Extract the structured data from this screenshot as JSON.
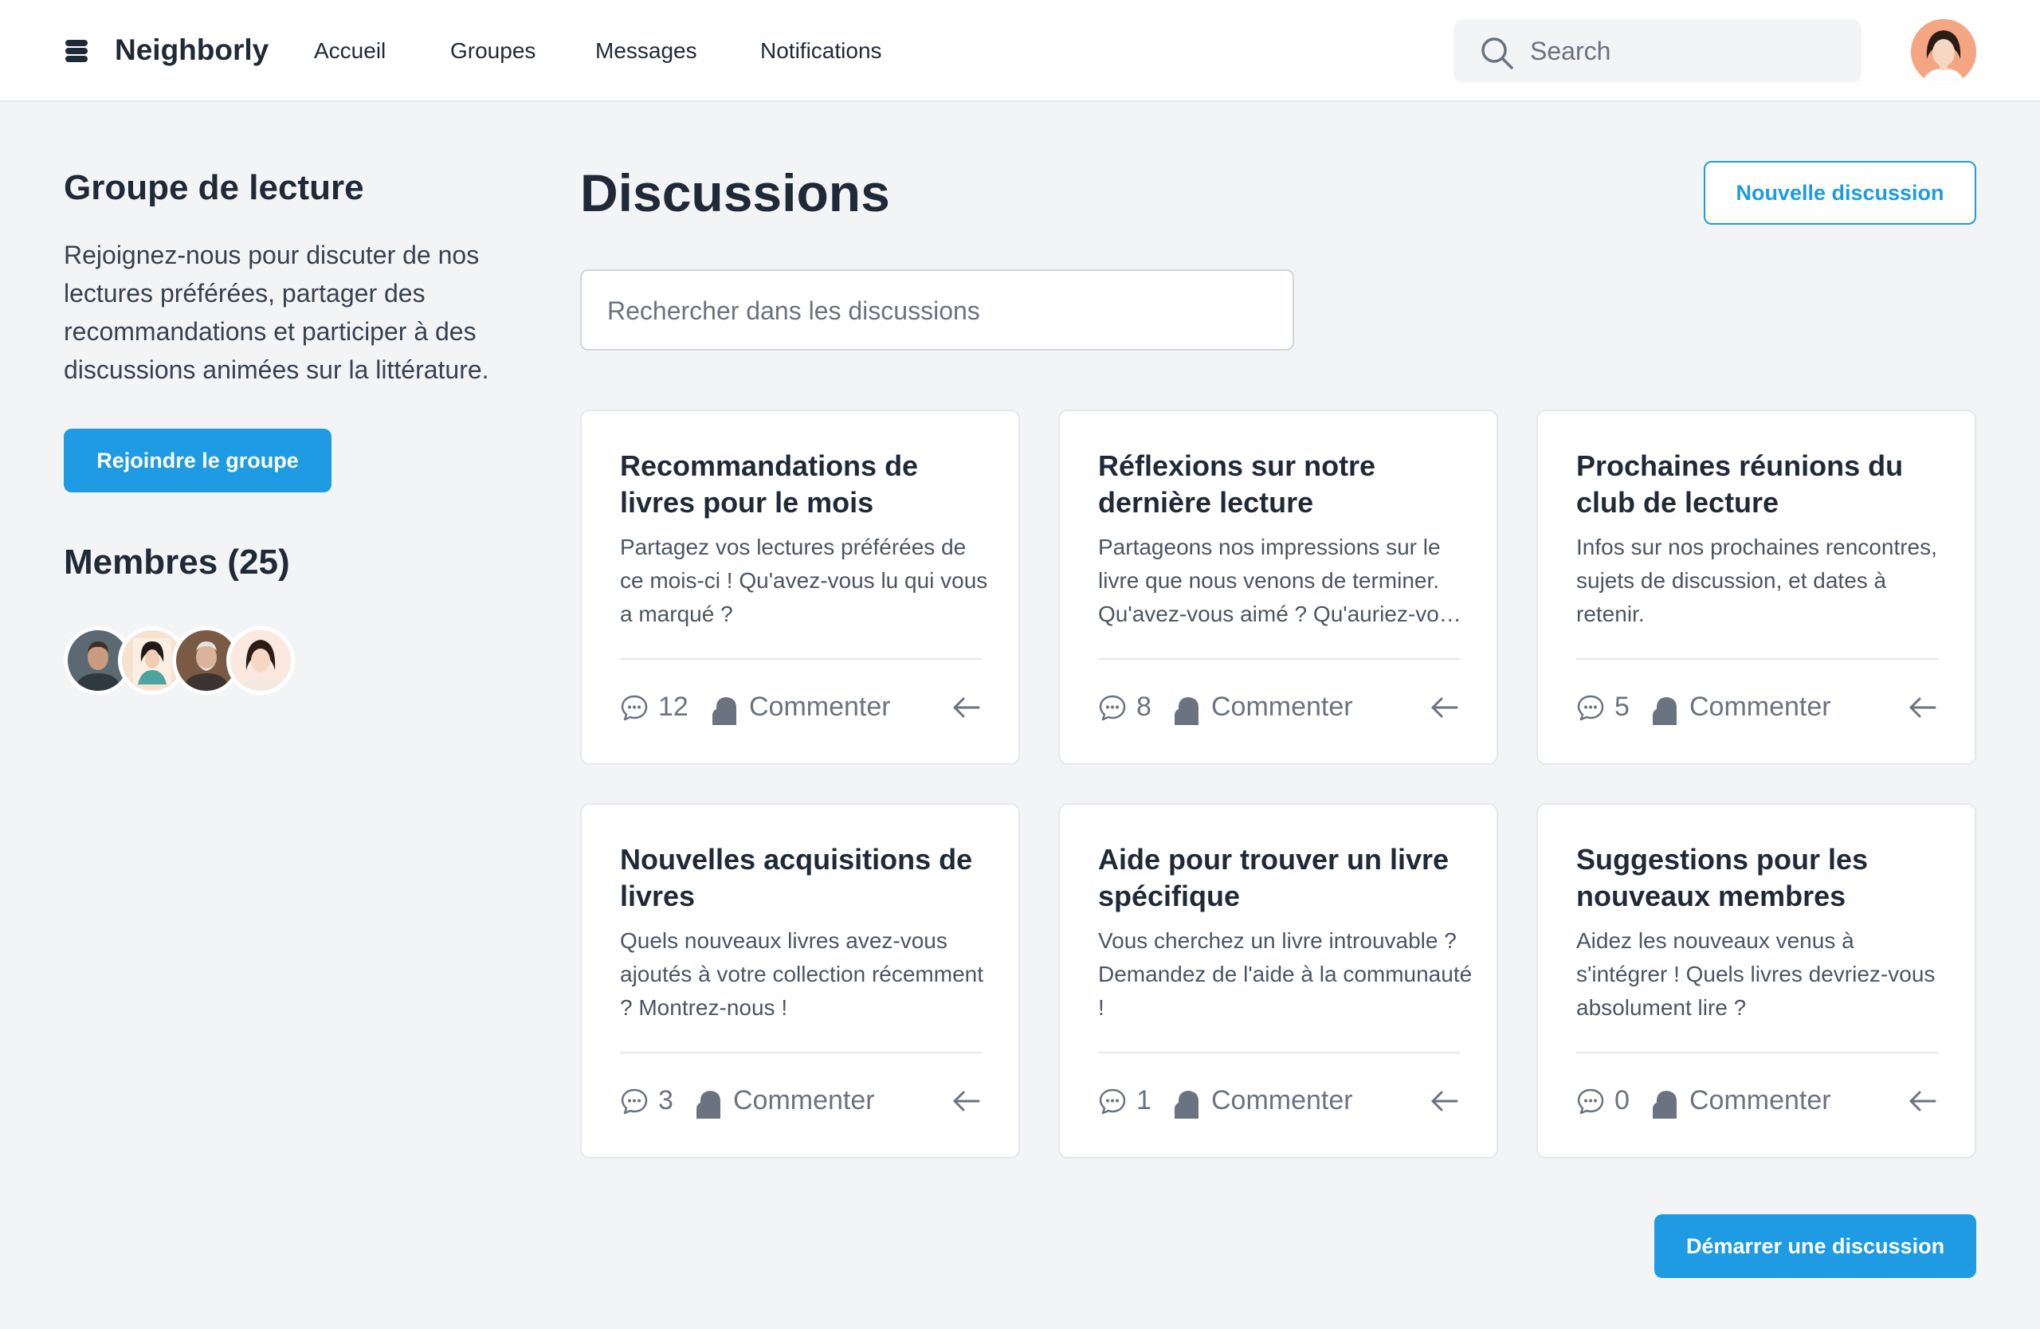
{
  "header": {
    "brand": "Neighborly",
    "logo_icon": "stack-icon",
    "nav": [
      {
        "label": "Accueil"
      },
      {
        "label": "Groupes"
      },
      {
        "label": "Messages"
      },
      {
        "label": "Notifications"
      }
    ],
    "search_placeholder": "Search",
    "search_icon": "search-icon"
  },
  "sidebar": {
    "group_title": "Groupe de lecture",
    "description": "Rejoignez-nous pour discuter de nos lectures préférées, partager des recommandations et participer à des discussions animées sur la littérature.",
    "join_label": "Rejoindre le groupe",
    "members_title": "Membres (25)"
  },
  "main": {
    "title": "Discussions",
    "new_label": "Nouvelle discussion",
    "search_placeholder": "Rechercher dans les discussions",
    "start_label": "Démarrer une discussion",
    "cards": [
      {
        "title": "Recommandations de livres pour le mois",
        "desc": "Partagez vos lectures préférées de ce mois-ci ! Qu'avez-vous lu qui vous a marqué ?",
        "count": "12",
        "action": "Commenter"
      },
      {
        "title": "Réflexions sur notre dernière lecture",
        "desc": "Partageons nos impressions sur le livre que nous venons de terminer. Qu'avez-vous aimé ? Qu'auriez-vous changé ?",
        "count": "8",
        "action": "Commenter"
      },
      {
        "title": "Prochaines réunions du club de lecture",
        "desc": "Infos sur nos prochaines rencontres, sujets de discussion, et dates à retenir.",
        "count": "5",
        "action": "Commenter"
      },
      {
        "title": "Nouvelles acquisitions de livres",
        "desc": "Quels nouveaux livres avez-vous ajoutés à votre collection récemment ? Montrez-nous !",
        "count": "3",
        "action": "Commenter"
      },
      {
        "title": "Aide pour trouver un livre spécifique",
        "desc": "Vous cherchez un livre introuvable ? Demandez de l'aide à la communauté !",
        "count": "1",
        "action": "Commenter"
      },
      {
        "title": "Suggestions pour les nouveaux membres",
        "desc": "Aidez les nouveaux venus à s'intégrer ! Quels livres devriez-vous absolument lire ?",
        "count": "0",
        "action": "Commenter"
      }
    ]
  },
  "colors": {
    "accent": "#1e9be2",
    "background": "#f3f4f6",
    "text": "#1f2937"
  }
}
